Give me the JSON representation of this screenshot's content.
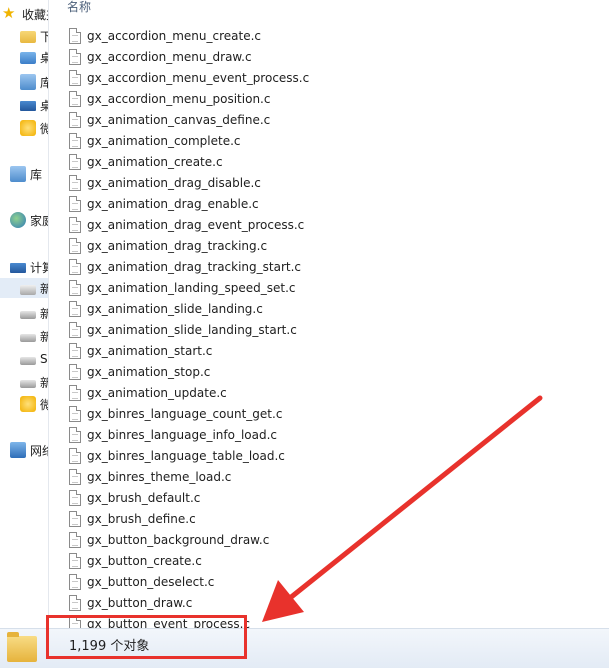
{
  "nav": {
    "items": [
      {
        "label": "收藏夹",
        "icon": "star-icon",
        "indent": 0
      },
      {
        "label": "下载",
        "icon": "download-folder-icon",
        "indent": 1
      },
      {
        "label": "桌面",
        "icon": "desktop-folder-icon",
        "indent": 1
      },
      {
        "label": "库",
        "icon": "library-folder-icon",
        "indent": 1
      },
      {
        "label": "桌面",
        "icon": "desktop-icon",
        "indent": 1
      },
      {
        "label": "微云",
        "icon": "cloud-icon",
        "indent": 1
      },
      {
        "label": "库",
        "icon": "library-icon",
        "indent": 0
      },
      {
        "label": "家庭组",
        "icon": "homegroup-icon",
        "indent": 0
      },
      {
        "label": "计算机",
        "icon": "computer-icon",
        "indent": 0
      },
      {
        "label": "新加卷",
        "icon": "drive-c-icon",
        "indent": 1
      },
      {
        "label": "新加卷",
        "icon": "drive-icon",
        "indent": 1
      },
      {
        "label": "新加卷",
        "icon": "drive-icon",
        "indent": 1
      },
      {
        "label": "SD",
        "icon": "drive-icon",
        "indent": 1
      },
      {
        "label": "新加卷",
        "icon": "drive-icon",
        "indent": 1
      },
      {
        "label": "微云",
        "icon": "cloud-icon",
        "indent": 1
      },
      {
        "label": "网络",
        "icon": "network-icon",
        "indent": 0
      }
    ]
  },
  "columns": {
    "name": "名称"
  },
  "files": [
    "gx_accordion_menu_create.c",
    "gx_accordion_menu_draw.c",
    "gx_accordion_menu_event_process.c",
    "gx_accordion_menu_position.c",
    "gx_animation_canvas_define.c",
    "gx_animation_complete.c",
    "gx_animation_create.c",
    "gx_animation_drag_disable.c",
    "gx_animation_drag_enable.c",
    "gx_animation_drag_event_process.c",
    "gx_animation_drag_tracking.c",
    "gx_animation_drag_tracking_start.c",
    "gx_animation_landing_speed_set.c",
    "gx_animation_slide_landing.c",
    "gx_animation_slide_landing_start.c",
    "gx_animation_start.c",
    "gx_animation_stop.c",
    "gx_animation_update.c",
    "gx_binres_language_count_get.c",
    "gx_binres_language_info_load.c",
    "gx_binres_language_table_load.c",
    "gx_binres_theme_load.c",
    "gx_brush_default.c",
    "gx_brush_define.c",
    "gx_button_background_draw.c",
    "gx_button_create.c",
    "gx_button_deselect.c",
    "gx_button_draw.c",
    "gx_button_event_process.c"
  ],
  "status": {
    "count_text": "1,199 个对象"
  },
  "annotation": {
    "color": "#e8322c"
  }
}
